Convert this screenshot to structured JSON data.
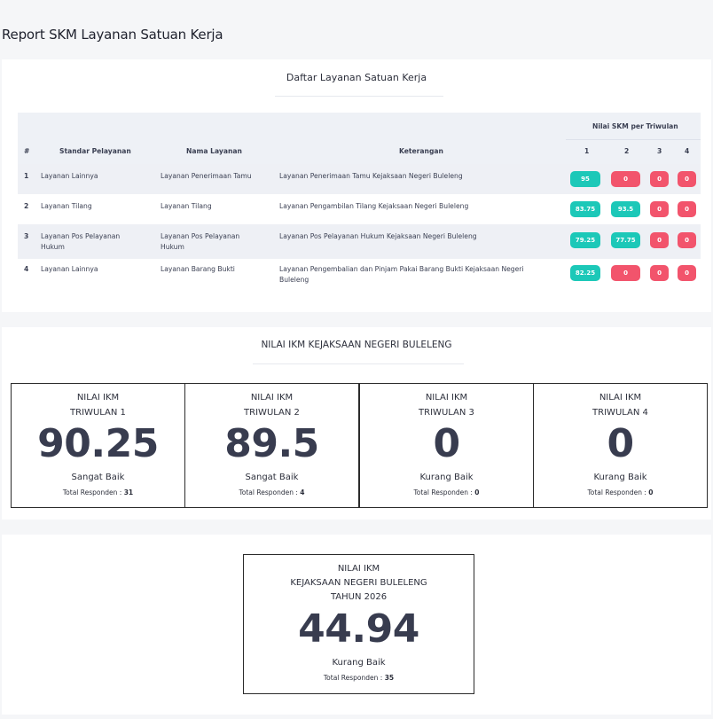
{
  "page": {
    "title": "Report SKM Layanan Satuan Kerja"
  },
  "services_table": {
    "heading": "Daftar Layanan Satuan Kerja",
    "columns": {
      "no": "#",
      "standar": "Standar Pelayanan",
      "nama": "Nama Layanan",
      "keterangan": "Keterangan",
      "nilai_group": "Nilai SKM per Triwulan",
      "q": [
        "1",
        "2",
        "3",
        "4"
      ]
    },
    "rows": [
      {
        "no": "1",
        "standar": "Layanan Lainnya",
        "nama": "Layanan Penerimaan Tamu",
        "keterangan": "Layanan Penerimaan Tamu Kejaksaan Negeri Buleleng",
        "scores": [
          "95",
          "0",
          "0",
          "0"
        ]
      },
      {
        "no": "2",
        "standar": "Layanan Tilang",
        "nama": "Layanan Tilang",
        "keterangan": "Layanan Pengambilan Tilang Kejaksaan Negeri Buleleng",
        "scores": [
          "83.75",
          "93.5",
          "0",
          "0"
        ]
      },
      {
        "no": "3",
        "standar": "Layanan Pos Pelayanan Hukum",
        "nama": "Layanan Pos Pelayanan Hukum",
        "keterangan": "Layanan Pos Pelayanan Hukum Kejaksaan Negeri Buleleng",
        "scores": [
          "79.25",
          "77.75",
          "0",
          "0"
        ]
      },
      {
        "no": "4",
        "standar": "Layanan Lainnya",
        "nama": "Layanan Barang Bukti",
        "keterangan": "Layanan Pengembalian dan Pinjam Pakai Barang Bukti Kejaksaan Negeri Buleleng",
        "scores": [
          "82.25",
          "0",
          "0",
          "0"
        ]
      }
    ],
    "colors": {
      "good": "#1cc8b8",
      "zero": "#f2546c"
    }
  },
  "ikm_quarterly": {
    "heading": "NILAI IKM KEJAKSAAN NEGERI BULELENG",
    "responden_label": "Total Responden : ",
    "boxes": [
      {
        "label1": "NILAI IKM",
        "label2": "TRIWULAN 1",
        "value": "90.25",
        "status": "Sangat Baik",
        "responden": "31"
      },
      {
        "label1": "NILAI IKM",
        "label2": "TRIWULAN 2",
        "value": "89.5",
        "status": "Sangat Baik",
        "responden": "4"
      },
      {
        "label1": "NILAI IKM",
        "label2": "TRIWULAN 3",
        "value": "0",
        "status": "Kurang Baik",
        "responden": "0"
      },
      {
        "label1": "NILAI IKM",
        "label2": "TRIWULAN 4",
        "value": "0",
        "status": "Kurang Baik",
        "responden": "0"
      }
    ]
  },
  "ikm_year": {
    "label1": "NILAI IKM",
    "label2": "KEJAKSAAN NEGERI BULELENG",
    "label3": "TAHUN 2026",
    "value": "44.94",
    "status": "Kurang Baik",
    "responden_label": "Total Responden : ",
    "responden": "35"
  }
}
